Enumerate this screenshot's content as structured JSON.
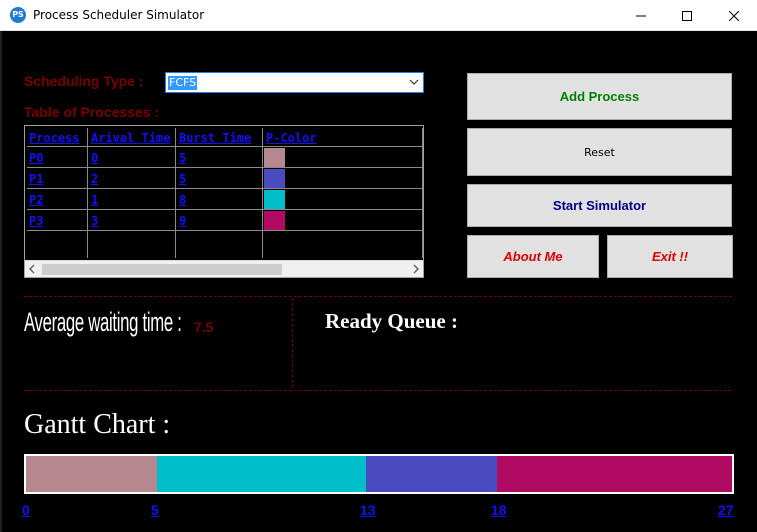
{
  "window": {
    "title": "Process Scheduler Simulator",
    "icon_text": "PS"
  },
  "scheduling": {
    "label": "Scheduling Type :",
    "selected": "FCFS"
  },
  "table": {
    "label": "Table of Processes :",
    "headers": [
      "Process",
      "Arival Time",
      "Burst Time",
      "P-Color"
    ],
    "rows": [
      {
        "process": "P0",
        "arrival": "0",
        "burst": "5",
        "color": "#b5888f"
      },
      {
        "process": "P1",
        "arrival": "2",
        "burst": "5",
        "color": "#4b4bc1"
      },
      {
        "process": "P2",
        "arrival": "1",
        "burst": "8",
        "color": "#00bfcb"
      },
      {
        "process": "P3",
        "arrival": "3",
        "burst": "9",
        "color": "#b00a62"
      }
    ]
  },
  "buttons": {
    "add": "Add Process",
    "reset": "Reset",
    "start": "Start Simulator",
    "about": "About Me",
    "exit": "Exit !!"
  },
  "stats": {
    "avg_label": "Average waiting time :",
    "avg_value": "7.5",
    "ready_label": "Ready Queue :"
  },
  "gantt": {
    "label": "Gantt Chart :",
    "total": 27,
    "segments": [
      {
        "process": "P0",
        "start": 0,
        "end": 5,
        "color": "#b5888f"
      },
      {
        "process": "P2",
        "start": 5,
        "end": 13,
        "color": "#00bfcb"
      },
      {
        "process": "P1",
        "start": 13,
        "end": 18,
        "color": "#4b4bc1"
      },
      {
        "process": "P3",
        "start": 18,
        "end": 27,
        "color": "#b00a62"
      }
    ],
    "ticks": [
      "0",
      "5",
      "13",
      "18",
      "27"
    ]
  },
  "colors": {
    "label_dark_red": "#7a0000",
    "link_blue": "#1010ff",
    "add_green": "#008000",
    "start_navy": "#00008b",
    "exit_red": "#e00000"
  }
}
